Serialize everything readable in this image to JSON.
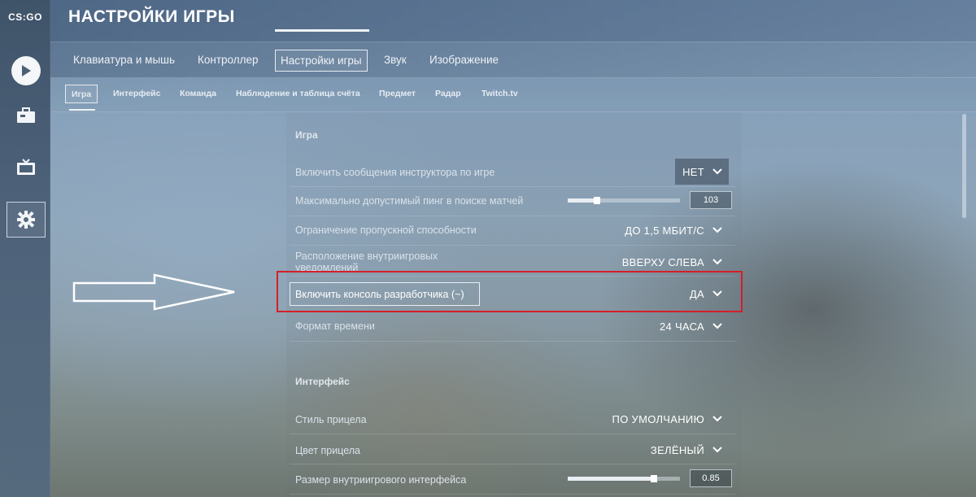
{
  "app": {
    "logo_text": "CS:GO"
  },
  "header": {
    "title": "НАСТРОЙКИ ИГРЫ"
  },
  "sidebar": {
    "items": [
      {
        "name": "play",
        "icon": "play-icon"
      },
      {
        "name": "inventory",
        "icon": "briefcase-icon"
      },
      {
        "name": "watch",
        "icon": "tv-icon"
      },
      {
        "name": "settings",
        "icon": "gear-icon",
        "active": true
      }
    ]
  },
  "tabs": [
    {
      "label": "Клавиатура и мышь"
    },
    {
      "label": "Контроллер"
    },
    {
      "label": "Настройки игры",
      "active": true
    },
    {
      "label": "Звук"
    },
    {
      "label": "Изображение"
    }
  ],
  "subtabs": [
    {
      "label": "Игра",
      "active": true
    },
    {
      "label": "Интерфейс"
    },
    {
      "label": "Команда"
    },
    {
      "label": "Наблюдение и таблица счёта"
    },
    {
      "label": "Предмет"
    },
    {
      "label": "Радар"
    },
    {
      "label": "Twitch.tv"
    }
  ],
  "sections": {
    "game": {
      "title": "Игра",
      "rows": [
        {
          "label": "Включить сообщения инструктора по игре",
          "value": "НЕТ",
          "type": "dropdown"
        },
        {
          "label": "Максимально допустимый пинг в поиске матчей",
          "value": "103",
          "type": "slider",
          "level": 0.26
        },
        {
          "label": "Ограничение пропускной способности",
          "value": "ДО 1,5 МБИТ/С",
          "type": "dropdown"
        },
        {
          "label": "Расположение внутриигровых уведомлений",
          "value": "ВВЕРХУ СЛЕВА",
          "type": "dropdown"
        },
        {
          "label": "Включить консоль разработчика (~)",
          "value": "ДА",
          "type": "dropdown",
          "highlighted": true
        },
        {
          "label": "Формат времени",
          "value": "24 ЧАСА",
          "type": "dropdown"
        }
      ]
    },
    "interface": {
      "title": "Интерфейс",
      "rows": [
        {
          "label": "Стиль прицела",
          "value": "ПО УМОЛЧАНИЮ",
          "type": "dropdown"
        },
        {
          "label": "Цвет прицела",
          "value": "ЗЕЛЁНЫЙ",
          "type": "dropdown"
        },
        {
          "label": "Размер внутриигрового интерфейса",
          "value": "0.85",
          "type": "slider",
          "level": 0.77
        }
      ]
    }
  },
  "colors": {
    "highlight": "#d41f2a",
    "text": "#ffffff"
  }
}
